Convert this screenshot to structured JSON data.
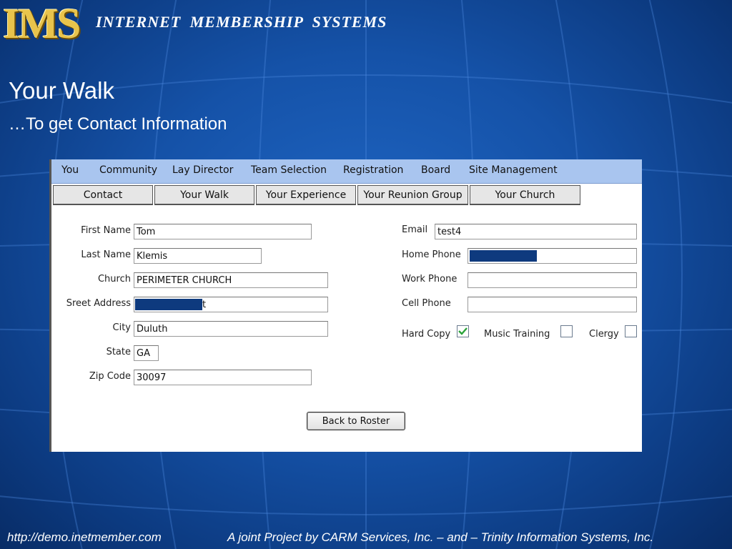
{
  "header": {
    "logo": "IMS",
    "brand": "INTERNET   MEMBERSHIP  SYSTEMS"
  },
  "slide": {
    "title": "Your Walk",
    "subtitle": "…To get Contact Information"
  },
  "menu": [
    "You",
    "Community",
    "Lay Director",
    "Team Selection",
    "Registration",
    "Board",
    "Site Management"
  ],
  "tabs": [
    "Contact",
    "Your Walk",
    "Your Experience",
    "Your Reunion Group",
    "Your Church"
  ],
  "form": {
    "first_name": {
      "label": "First Name",
      "value": "Tom"
    },
    "last_name": {
      "label": "Last Name",
      "value": "Klemis"
    },
    "church": {
      "label": "Church",
      "value": "PERIMETER CHURCH"
    },
    "street": {
      "label": "Sreet Address",
      "value": "t"
    },
    "city": {
      "label": "City",
      "value": "Duluth"
    },
    "state": {
      "label": "State",
      "value": "GA"
    },
    "zip": {
      "label": "Zip Code",
      "value": "30097"
    },
    "email": {
      "label": "Email",
      "value": "test4"
    },
    "home_phone": {
      "label": "Home Phone",
      "value": ""
    },
    "work_phone": {
      "label": "Work Phone",
      "value": ""
    },
    "cell_phone": {
      "label": "Cell Phone",
      "value": ""
    },
    "hard_copy": {
      "label": "Hard Copy",
      "checked": true
    },
    "music_training": {
      "label": "Music Training",
      "checked": false
    },
    "clergy": {
      "label": "Clergy",
      "checked": false
    },
    "back_button": "Back to Roster"
  },
  "footer": {
    "url": "http://demo.inetmember.com",
    "credit": "A joint Project by CARM Services, Inc. – and – Trinity Information Systems, Inc."
  },
  "colors": {
    "menubar": "#a9c5ef",
    "redaction": "#0e3a7e",
    "check": "#2aa33a"
  }
}
